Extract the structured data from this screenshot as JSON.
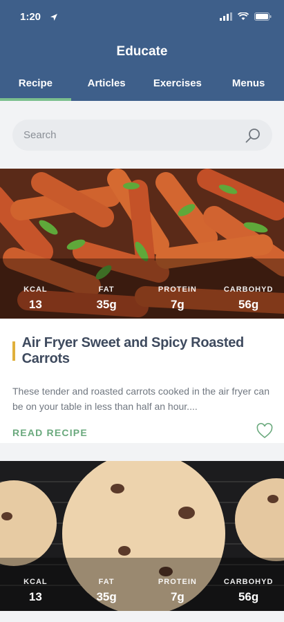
{
  "status": {
    "time": "1:20"
  },
  "app": {
    "title": "Educate"
  },
  "tabs": [
    {
      "label": "Recipe",
      "active": true
    },
    {
      "label": "Articles",
      "active": false
    },
    {
      "label": "Exercises",
      "active": false
    },
    {
      "label": "Menus",
      "active": false
    }
  ],
  "search": {
    "placeholder": "Search",
    "icon": "search-icon"
  },
  "cards": [
    {
      "image": "roasted-carrots-photo",
      "macros": [
        {
          "label": "KCAL",
          "value": "13"
        },
        {
          "label": "FAT",
          "value": "35g"
        },
        {
          "label": "PROTEIN",
          "value": "7g"
        },
        {
          "label": "CARBOHYD",
          "value": "56g"
        }
      ],
      "title": "Air Fryer Sweet and Spicy Roasted Carrots",
      "description": "These tender and roasted carrots cooked in the air fryer can be on your table in less than half an hour....",
      "read_label": "READ RECIPE",
      "favorite_icon": "heart-icon"
    },
    {
      "image": "cookies-photo",
      "macros": [
        {
          "label": "KCAL",
          "value": "13"
        },
        {
          "label": "FAT",
          "value": "35g"
        },
        {
          "label": "PROTEIN",
          "value": "7g"
        },
        {
          "label": "CARBOHYD",
          "value": "56g"
        }
      ]
    }
  ],
  "colors": {
    "header": "#3e5f8a",
    "accent": "#6aa97d",
    "title_bar": "#e0b03c"
  }
}
